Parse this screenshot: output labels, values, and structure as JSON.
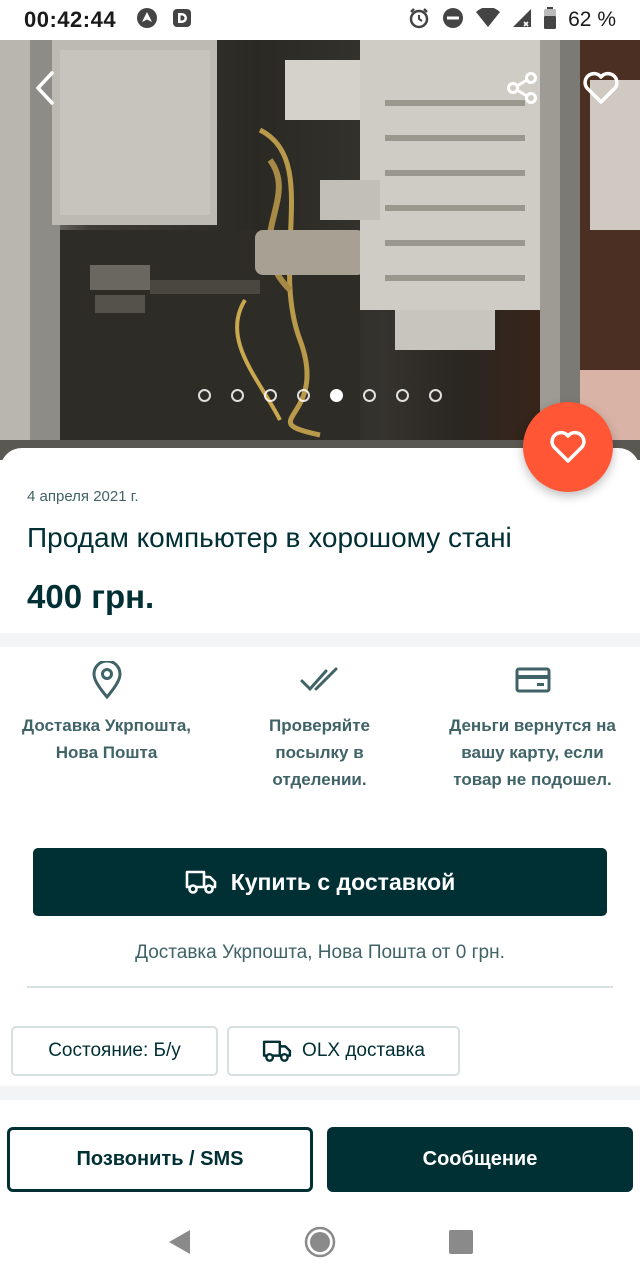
{
  "status_bar": {
    "time": "00:42:44",
    "battery": "62 %",
    "left_icons": [
      "nav-app-icon",
      "d-app-icon"
    ],
    "right_icons": [
      "alarm-icon",
      "dnd-icon",
      "wifi-icon",
      "signal-icon",
      "battery-icon"
    ]
  },
  "gallery": {
    "image_description_icon": "photo",
    "dot_count": 8,
    "active_dot": 5
  },
  "listing": {
    "date": "4 апреля 2021 г.",
    "title": "Продам компьютер в хорошому стані",
    "price": "400 грн."
  },
  "features": [
    {
      "icon": "location-pin-icon",
      "text": "Доставка Укрпошта, Нова Пошта"
    },
    {
      "icon": "double-check-icon",
      "text": "Проверяйте посылку в отделении."
    },
    {
      "icon": "credit-card-icon",
      "text": "Деньги вернутся на вашу карту, если товар не подошел."
    }
  ],
  "buy_button": {
    "label": "Купить с доставкой",
    "icon": "truck-icon"
  },
  "delivery_note": "Доставка Укрпошта, Нова Пошта от 0 грн.",
  "chips": [
    {
      "label": "Состояние: Б/у"
    },
    {
      "label": "OLX доставка",
      "icon": "truck-icon"
    }
  ],
  "actions": {
    "call_label": "Позвонить / SMS",
    "message_label": "Сообщение"
  },
  "colors": {
    "brand_dark": "#002f34",
    "favorite_accent": "#ff5636",
    "muted_text": "#406367"
  }
}
